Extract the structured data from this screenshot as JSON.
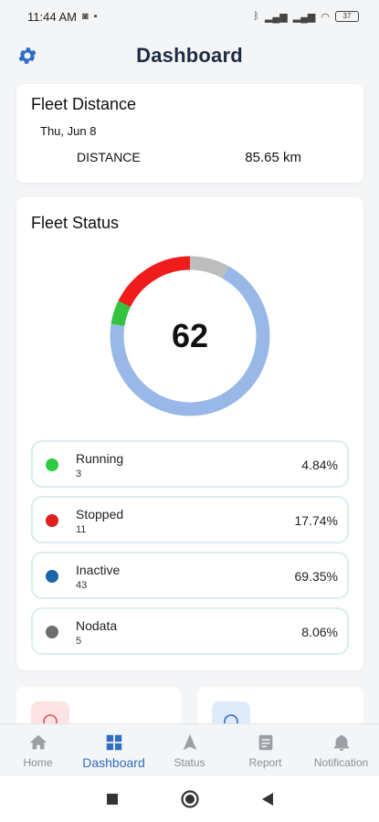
{
  "status_bar": {
    "time": "11:44 AM",
    "battery": "37",
    "icons": [
      "whatsapp-icon",
      "app-notification-icon",
      "bluetooth-icon",
      "signal-icon",
      "signal-icon",
      "wifi-icon",
      "battery-icon"
    ]
  },
  "header": {
    "title": "Dashboard",
    "settings_icon": "gear-icon"
  },
  "fleet_distance": {
    "title": "Fleet Distance",
    "date": "Thu, Jun 8",
    "label": "DISTANCE",
    "value": "85.65 km"
  },
  "fleet_status": {
    "title": "Fleet Status",
    "total": "62",
    "items": [
      {
        "name": "Running",
        "count": "3",
        "percent": "4.84%",
        "color": "#2ecc40"
      },
      {
        "name": "Stopped",
        "count": "11",
        "percent": "17.74%",
        "color": "#e02020"
      },
      {
        "name": "Inactive",
        "count": "43",
        "percent": "69.35%",
        "color": "#1c64a8"
      },
      {
        "name": "Nodata",
        "count": "5",
        "percent": "8.06%",
        "color": "#6e6e6e"
      }
    ],
    "ring_colors": {
      "running": "#34c23f",
      "stopped": "#f01c1c",
      "inactive": "#99b8e8",
      "nodata": "#bdbdbd"
    }
  },
  "tabs": [
    {
      "label": "Home",
      "icon": "home-icon",
      "active": false
    },
    {
      "label": "Dashboard",
      "icon": "dashboard-icon",
      "active": true
    },
    {
      "label": "Status",
      "icon": "navigation-arrow-icon",
      "active": false
    },
    {
      "label": "Report",
      "icon": "report-icon",
      "active": false
    },
    {
      "label": "Notification",
      "icon": "bell-icon",
      "active": false
    }
  ],
  "colors": {
    "accent": "#2f6ec5",
    "title": "#1f2a44",
    "background": "#f4f5f6"
  }
}
